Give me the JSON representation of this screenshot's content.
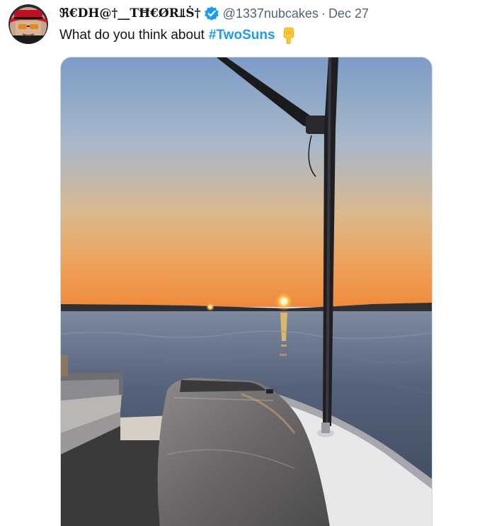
{
  "tweet": {
    "author": {
      "display_name": "ℜ€DH@†__TĦ€ØR⫫Ṡ†",
      "handle": "@1337nubcakes",
      "avatar_icon": "avatar-red-hat-sunglasses",
      "verified_icon": "verified-badge-icon"
    },
    "separator": "·",
    "date": "Dec 27",
    "text": "What do you think about",
    "hashtag": "#TwoSuns",
    "emoji_icon": "pointing-down-emoji-icon",
    "media": {
      "description_icon": "sunset-lake-boat-photo"
    }
  },
  "colors": {
    "text": "#0f1419",
    "secondary": "#536471",
    "link": "#1d9bf0",
    "verified": "#1d9bf0"
  }
}
